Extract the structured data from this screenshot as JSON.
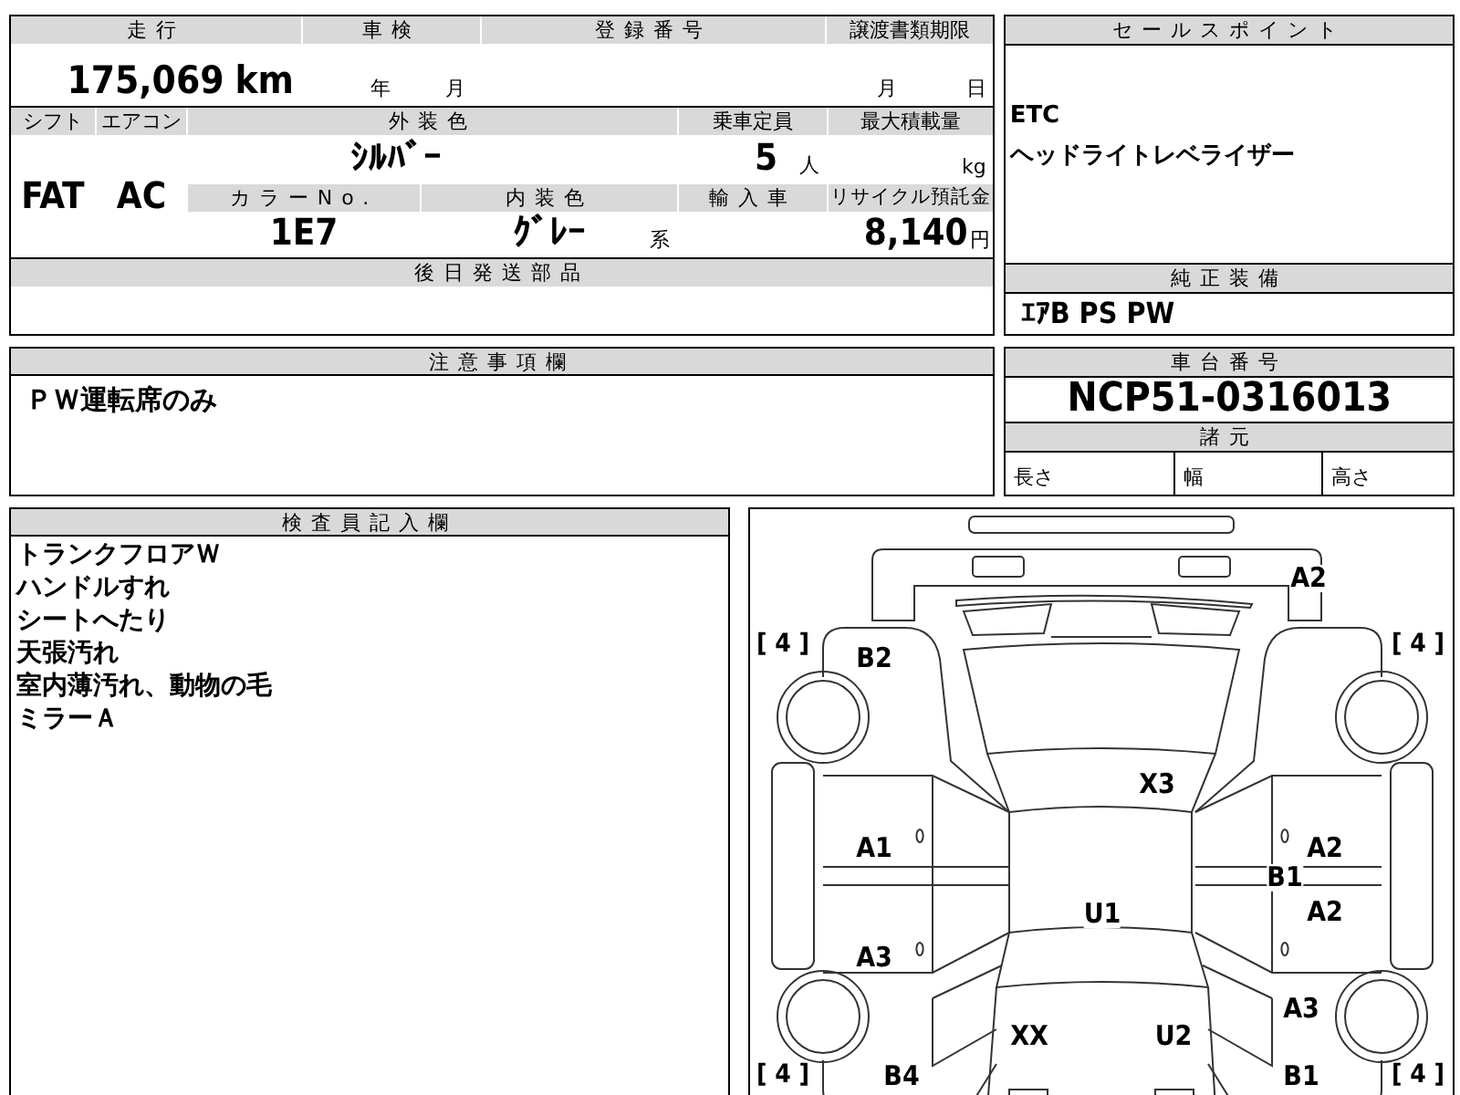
{
  "vehicle_table": {
    "mileage": {
      "label": "走行",
      "value": "175,069",
      "unit": "km"
    },
    "inspection": {
      "label": "車検",
      "year_unit": "年",
      "month_unit": "月"
    },
    "registration": {
      "label": "登録番号"
    },
    "transfer_deadline": {
      "label": "譲渡書類期限",
      "month_unit": "月",
      "day_unit": "日"
    },
    "shift": {
      "label": "シフト",
      "value": "FAT"
    },
    "aircon": {
      "label": "エアコン",
      "value": "AC"
    },
    "exterior_color": {
      "label": "外装色",
      "value": "ｼﾙﾊﾞｰ"
    },
    "capacity": {
      "label": "乗車定員",
      "value": "5",
      "unit": "人"
    },
    "max_load": {
      "label": "最大積載量",
      "unit": "kg"
    },
    "color_no": {
      "label": "カラーNo.",
      "value": "1E7"
    },
    "interior_color": {
      "label": "内装色",
      "value": "ｸﾞﾚｰ",
      "suffix": "系"
    },
    "import_car": {
      "label": "輸入車"
    },
    "recycle_fee": {
      "label": "リサイクル預託金",
      "value": "8,140",
      "unit": "円"
    },
    "later_parts": {
      "label": "後日発送部品"
    }
  },
  "sales_points": {
    "label": "セールスポイント",
    "lines": [
      "ETC",
      "ヘッドライトレベライザー"
    ]
  },
  "standard_equipment": {
    "label": "純正装備",
    "value": "ｴｱB PS PW"
  },
  "notes": {
    "label": "注意事項欄",
    "text": "ＰＷ運転席のみ"
  },
  "chassis": {
    "label": "車台番号",
    "value": "NCP51-0316013",
    "specs_label": "諸元",
    "specs": [
      "長さ",
      "幅",
      "高さ"
    ]
  },
  "inspector_notes": {
    "label": "検査員記入欄",
    "lines": [
      "トランクフロアＷ",
      "ハンドルすれ",
      "シートへたり",
      "天張汚れ",
      "室内薄汚れ、動物の毛",
      "ミラーＡ"
    ]
  },
  "damage_diagram": {
    "tire_marks": [
      "[ 4 ]",
      "[ 4 ]",
      "[ 4 ]",
      "[ 4 ]"
    ],
    "damage_codes": [
      "A2",
      "B2",
      "X3",
      "A1",
      "A2",
      "B1",
      "A2",
      "U1",
      "A3",
      "A3",
      "XX",
      "U2",
      "B4",
      "B1"
    ]
  }
}
